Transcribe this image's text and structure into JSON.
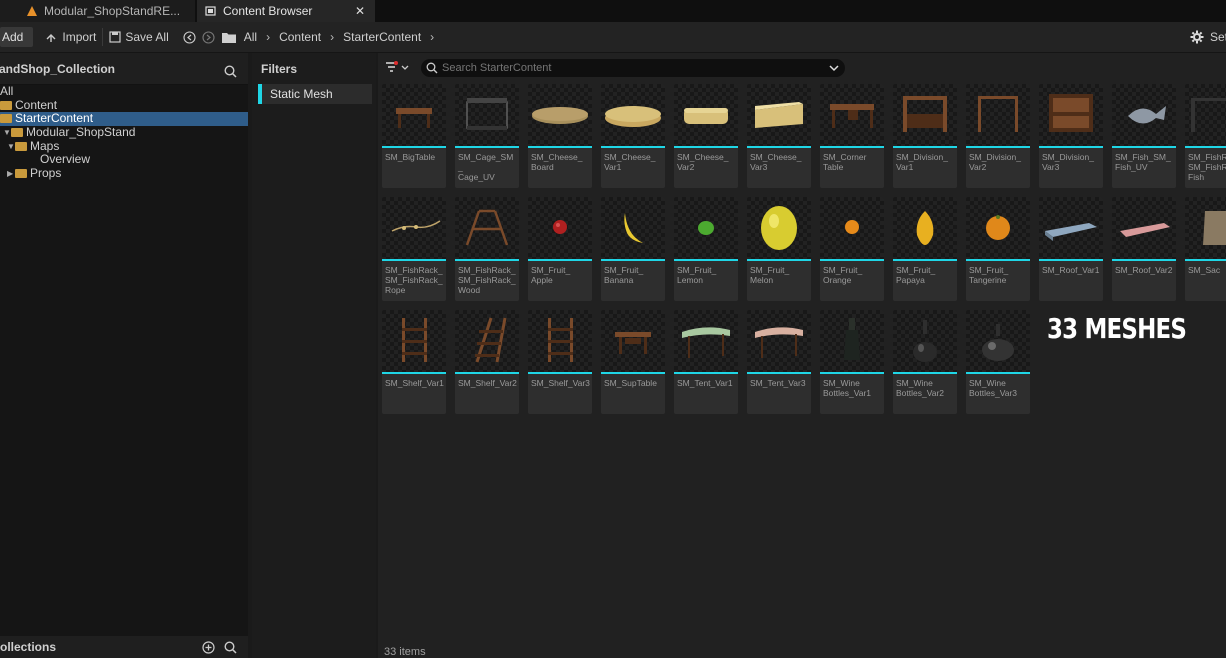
{
  "tabs": [
    {
      "label": "Modular_ShopStandRE..."
    },
    {
      "label": "Content Browser"
    }
  ],
  "toolbar": {
    "add_label": "Add",
    "import_label": "Import",
    "save_all_label": "Save All",
    "settings_label": "Set"
  },
  "breadcrumb": [
    "All",
    "Content",
    "StarterContent"
  ],
  "sources": {
    "title": "andShop_Collection",
    "tree": [
      {
        "label": "All",
        "indent": 0,
        "selected": false,
        "folder": false
      },
      {
        "label": "Content",
        "indent": 0,
        "selected": false,
        "folder": true
      },
      {
        "label": "StarterContent",
        "indent": 0,
        "selected": true,
        "folder": true
      },
      {
        "label": "Modular_ShopStand",
        "indent": 1,
        "selected": false,
        "folder": true
      },
      {
        "label": "Maps",
        "indent": 2,
        "selected": false,
        "folder": true
      },
      {
        "label": "Overview",
        "indent": 3,
        "selected": false,
        "folder": false
      },
      {
        "label": "Props",
        "indent": 2,
        "selected": false,
        "folder": true
      }
    ]
  },
  "collections": {
    "title": "ollections"
  },
  "filters": {
    "title": "Filters",
    "chips": [
      "Static Mesh"
    ]
  },
  "search": {
    "placeholder": "Search StarterContent"
  },
  "assets": [
    {
      "label": "SM_BigTable",
      "kind": "table"
    },
    {
      "label": "SM_Cage_SM_\nCage_UV",
      "kind": "cage"
    },
    {
      "label": "SM_Cheese_\nBoard",
      "kind": "board"
    },
    {
      "label": "SM_Cheese_\nVar1",
      "kind": "cheese1"
    },
    {
      "label": "SM_Cheese_\nVar2",
      "kind": "cheese2"
    },
    {
      "label": "SM_Cheese_\nVar3",
      "kind": "cheese3"
    },
    {
      "label": "SM_Corner\nTable",
      "kind": "corner"
    },
    {
      "label": "SM_Division_\nVar1",
      "kind": "division"
    },
    {
      "label": "SM_Division_\nVar2",
      "kind": "division2"
    },
    {
      "label": "SM_Division_\nVar3",
      "kind": "division3"
    },
    {
      "label": "SM_Fish_SM_\nFish_UV",
      "kind": "fish"
    },
    {
      "label": "SM_FishR\nSM_FishR\nFish",
      "kind": "fishrack"
    },
    {
      "label": "SM_FishRack_\nSM_FishRack_\nRope",
      "kind": "rope"
    },
    {
      "label": "SM_FishRack_\nSM_FishRack_\nWood",
      "kind": "wood"
    },
    {
      "label": "SM_Fruit_\nApple",
      "kind": "apple"
    },
    {
      "label": "SM_Fruit_\nBanana",
      "kind": "banana"
    },
    {
      "label": "SM_Fruit_\nLemon",
      "kind": "lemon"
    },
    {
      "label": "SM_Fruit_\nMelon",
      "kind": "melon"
    },
    {
      "label": "SM_Fruit_\nOrange",
      "kind": "orange"
    },
    {
      "label": "SM_Fruit_\nPapaya",
      "kind": "papaya"
    },
    {
      "label": "SM_Fruit_\nTangerine",
      "kind": "tangerine"
    },
    {
      "label": "SM_Roof_Var1",
      "kind": "roof1"
    },
    {
      "label": "SM_Roof_Var2",
      "kind": "roof2"
    },
    {
      "label": "SM_Sac",
      "kind": "sack"
    },
    {
      "label": "SM_Shelf_Var1",
      "kind": "shelf"
    },
    {
      "label": "SM_Shelf_Var2",
      "kind": "shelf2"
    },
    {
      "label": "SM_Shelf_Var3",
      "kind": "shelf"
    },
    {
      "label": "SM_SupTable",
      "kind": "suptable"
    },
    {
      "label": "SM_Tent_Var1",
      "kind": "tent1"
    },
    {
      "label": "SM_Tent_Var3",
      "kind": "tent3"
    },
    {
      "label": "SM_Wine\nBottles_Var1",
      "kind": "wine1"
    },
    {
      "label": "SM_Wine\nBottles_Var2",
      "kind": "wine2"
    },
    {
      "label": "SM_Wine\nBottles_Var3",
      "kind": "wine3"
    }
  ],
  "overlay_text": "33 MESHES",
  "status": {
    "item_count": "33 items"
  },
  "colors": {
    "accent": "#1fd6e6",
    "selection": "#2f5d8a",
    "folder": "#d6a84a"
  }
}
